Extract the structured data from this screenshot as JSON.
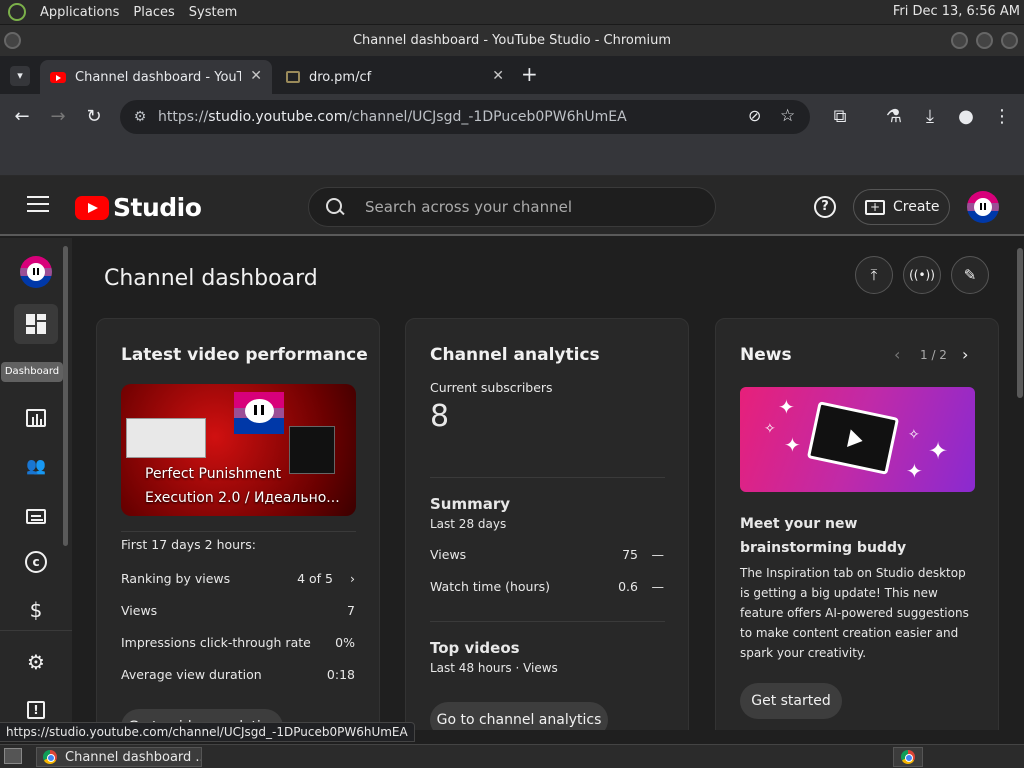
{
  "os_panel": {
    "menus": [
      "Applications",
      "Places",
      "System"
    ],
    "clock": "Fri Dec 13,  6:56 AM"
  },
  "window": {
    "title": "Channel dashboard - YouTube Studio - Chromium"
  },
  "tabs": [
    {
      "label": "Channel dashboard - YouTube Studio",
      "icon": "youtube-favicon",
      "active": true
    },
    {
      "label": "dro.pm/cf",
      "icon": "folder-favicon",
      "active": false
    }
  ],
  "tab_close": "✕",
  "new_tab": "+",
  "omnibox": {
    "url_scheme": "https://",
    "url_host": "studio.youtube.com",
    "url_path": "/channel/UCJsgd_-1DPuceb0PW6hUmEA"
  },
  "studio": {
    "logo_text": "Studio",
    "search_placeholder": "Search across your channel",
    "help": "?",
    "create_label": "Create"
  },
  "nav": {
    "tooltip": "Dashboard",
    "items": [
      "dashboard-icon",
      "analytics-icon",
      "community-icon",
      "subtitles-icon",
      "copyright-icon",
      "earn-icon",
      "settings-icon",
      "feedback-icon"
    ]
  },
  "page_title": "Channel dashboard",
  "latest": {
    "title": "Latest video performance",
    "video_title": "Perfect Punishment Execution 2.0 / Идеально...",
    "period": "First 17 days 2 hours:",
    "rows": [
      {
        "label": "Ranking by views",
        "value": "4 of 5"
      },
      {
        "label": "Views",
        "value": "7"
      },
      {
        "label": "Impressions click-through rate",
        "value": "0%"
      },
      {
        "label": "Average view duration",
        "value": "0:18"
      }
    ],
    "button": "Go to video analytics"
  },
  "analytics": {
    "title": "Channel analytics",
    "subs_label": "Current subscribers",
    "subs_value": "8",
    "summary_title": "Summary",
    "summary_period": "Last 28 days",
    "rows": [
      {
        "label": "Views",
        "value": "75",
        "trend": "—"
      },
      {
        "label": "Watch time (hours)",
        "value": "0.6",
        "trend": "—"
      }
    ],
    "top_title": "Top videos",
    "top_period": "Last 48 hours · Views",
    "button": "Go to channel analytics"
  },
  "news": {
    "title": "News",
    "pager": "1 / 2",
    "headline": "Meet your new brainstorming buddy",
    "body": "The Inspiration tab on Studio desktop is getting a big update! This new feature offers AI-powered suggestions to make content creation easier and spark your creativity.",
    "button": "Get started"
  },
  "status_url": "https://studio.youtube.com/channel/UCJsgd_-1DPuceb0PW6hUmEA",
  "taskbar": {
    "window_label": "Channel dashboard ..."
  },
  "colors": {
    "yt_red": "#ff0000",
    "bg": "#1f1f1f",
    "card": "#282828"
  }
}
